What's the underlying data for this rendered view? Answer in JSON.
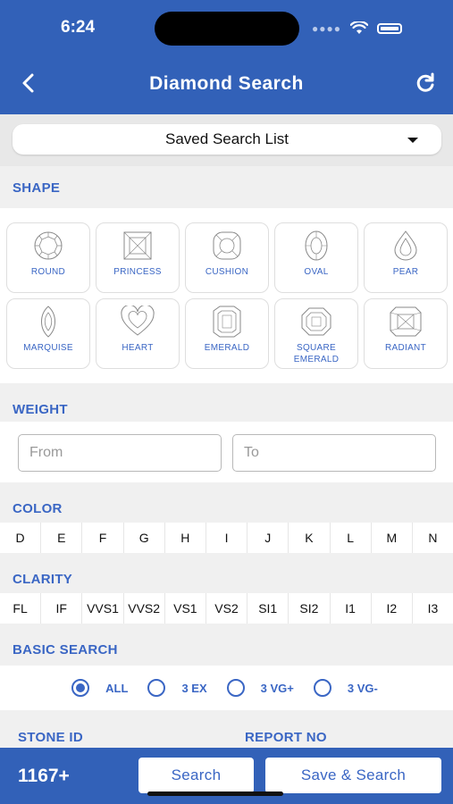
{
  "status": {
    "time": "6:24"
  },
  "header": {
    "title": "Diamond Search"
  },
  "saved_search": {
    "label": "Saved Search List"
  },
  "shape": {
    "label": "SHAPE",
    "items": [
      {
        "label": "ROUND",
        "icon": "round-icon"
      },
      {
        "label": "PRINCESS",
        "icon": "princess-icon"
      },
      {
        "label": "CUSHION",
        "icon": "cushion-icon"
      },
      {
        "label": "OVAL",
        "icon": "oval-icon"
      },
      {
        "label": "PEAR",
        "icon": "pear-icon"
      },
      {
        "label": "MARQUISE",
        "icon": "marquise-icon"
      },
      {
        "label": "HEART",
        "icon": "heart-icon"
      },
      {
        "label": "EMERALD",
        "icon": "emerald-icon"
      },
      {
        "label": "SQUARE EMERALD",
        "icon": "square-emerald-icon"
      },
      {
        "label": "RADIANT",
        "icon": "radiant-icon"
      }
    ]
  },
  "weight": {
    "label": "WEIGHT",
    "from_placeholder": "From",
    "to_placeholder": "To"
  },
  "color": {
    "label": "COLOR",
    "options": [
      "D",
      "E",
      "F",
      "G",
      "H",
      "I",
      "J",
      "K",
      "L",
      "M",
      "N"
    ]
  },
  "clarity": {
    "label": "CLARITY",
    "options": [
      "FL",
      "IF",
      "VVS1",
      "VVS2",
      "VS1",
      "VS2",
      "SI1",
      "SI2",
      "I1",
      "I2",
      "I3"
    ]
  },
  "basic_search": {
    "label": "BASIC SEARCH",
    "options": [
      "ALL",
      "3 EX",
      "3 VG+",
      "3 VG-"
    ],
    "selected": "ALL"
  },
  "stone_id_label": "STONE ID",
  "report_no_label": "REPORT NO",
  "footer": {
    "count": "1167+",
    "search_label": "Search",
    "save_search_label": "Save & Search"
  },
  "colors": {
    "primary": "#3261b8",
    "accent": "#3a66c4"
  }
}
